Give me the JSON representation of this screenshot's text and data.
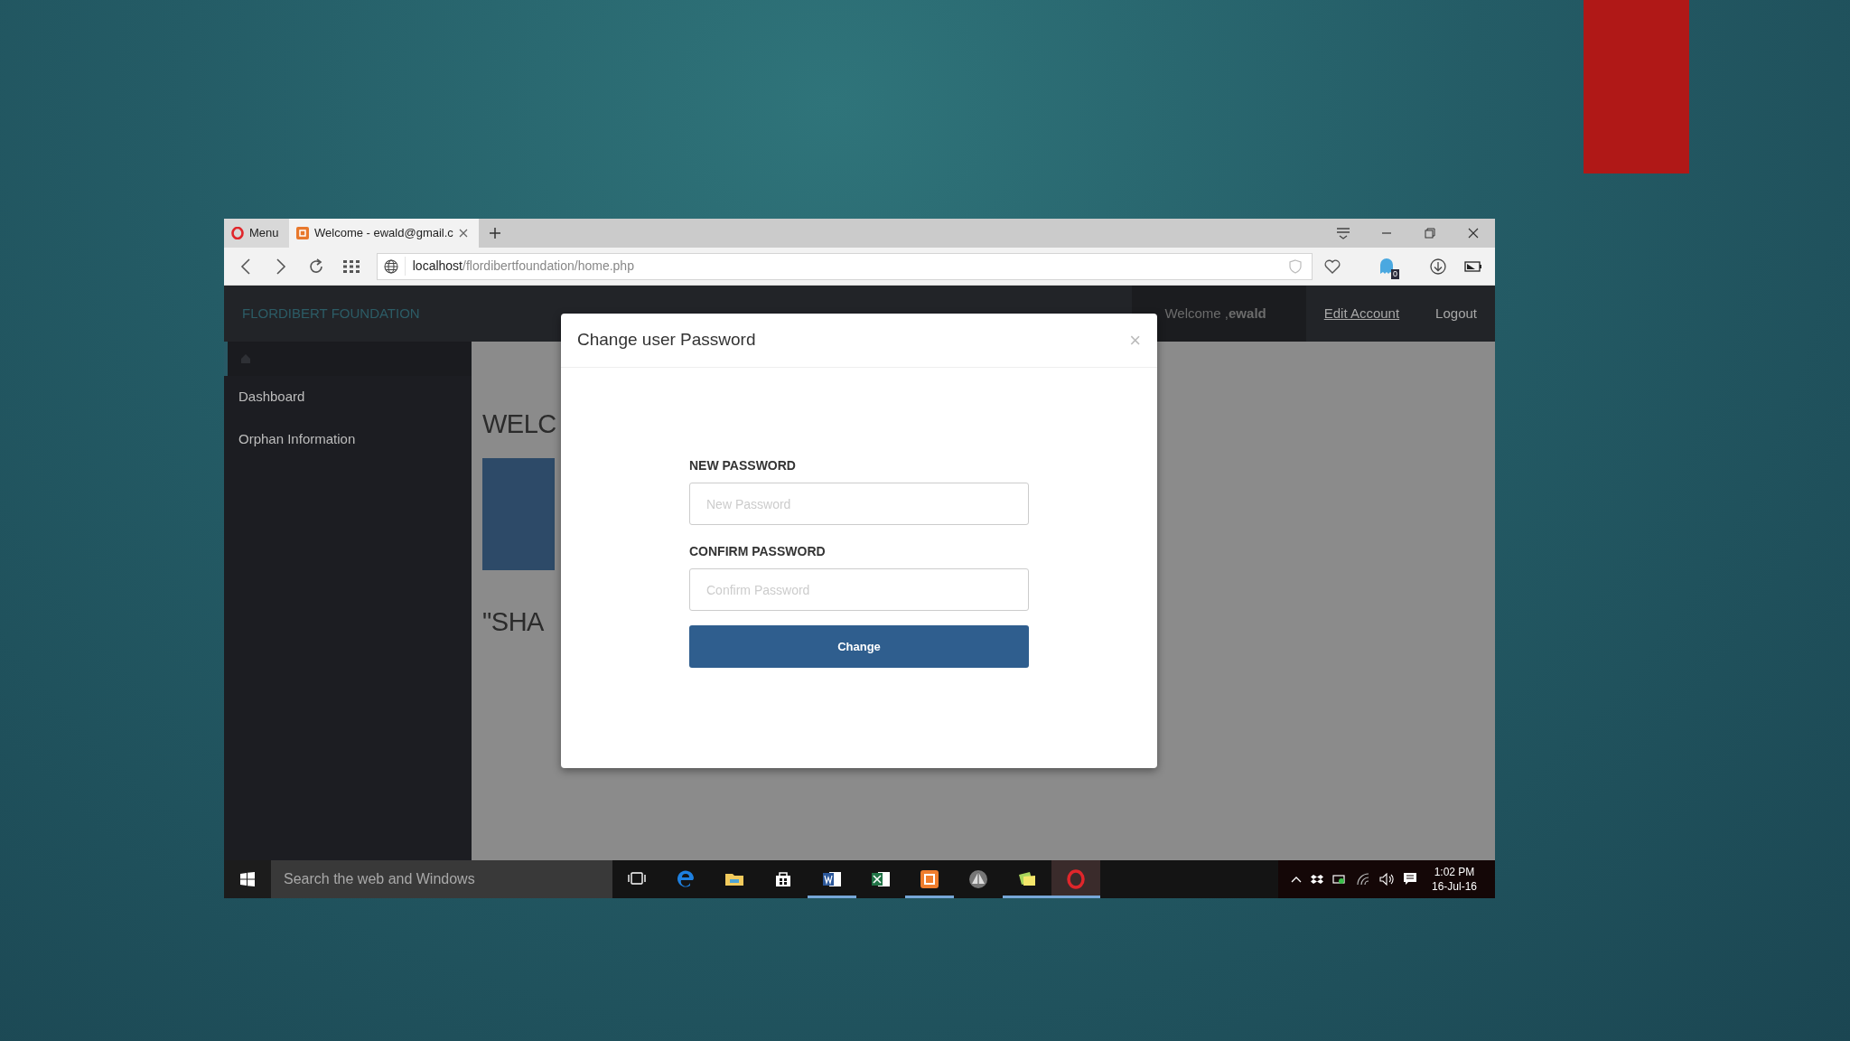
{
  "browser": {
    "tabs": [
      {
        "kind": "menu",
        "label": "Menu",
        "selected": false
      },
      {
        "kind": "page",
        "label": "Welcome - ewald@gmail.c",
        "selected": true
      }
    ],
    "address": {
      "host": "localhost",
      "path": "/flordibertfoundation/home.php"
    },
    "extension_badge": "0"
  },
  "site": {
    "brand": "FLORDIBERT FOUNDATION",
    "welcome": "Welcome ,**ewald**",
    "nav_links": [
      "Edit Account",
      "Logout"
    ],
    "sidebar": [
      {
        "label": "Dashboard"
      },
      {
        "label": "Orphan Information"
      }
    ],
    "heading": "WELC",
    "quote": "\"SHA"
  },
  "modal": {
    "title": "Change user Password",
    "close": "×",
    "fields": [
      {
        "label": "NEW PASSWORD",
        "placeholder": "New Password"
      },
      {
        "label": "CONFIRM PASSWORD",
        "placeholder": "Confirm Password"
      }
    ],
    "submit": "Change"
  },
  "taskbar": {
    "search_placeholder": "Search the web and Windows",
    "apps": [
      {
        "kind": "taskview",
        "running": false,
        "selected": false
      },
      {
        "kind": "edge",
        "running": false,
        "selected": false
      },
      {
        "kind": "explorer",
        "running": false,
        "selected": false
      },
      {
        "kind": "store",
        "running": false,
        "selected": false
      },
      {
        "kind": "word",
        "running": true,
        "selected": false
      },
      {
        "kind": "excel",
        "running": false,
        "selected": false
      },
      {
        "kind": "xampp",
        "running": true,
        "selected": false
      },
      {
        "kind": "pyramid",
        "running": false,
        "selected": false
      },
      {
        "kind": "notes",
        "running": true,
        "selected": false
      },
      {
        "kind": "opera",
        "running": true,
        "selected": true
      }
    ],
    "time": "1:02 PM",
    "date": "16-Jul-16"
  }
}
